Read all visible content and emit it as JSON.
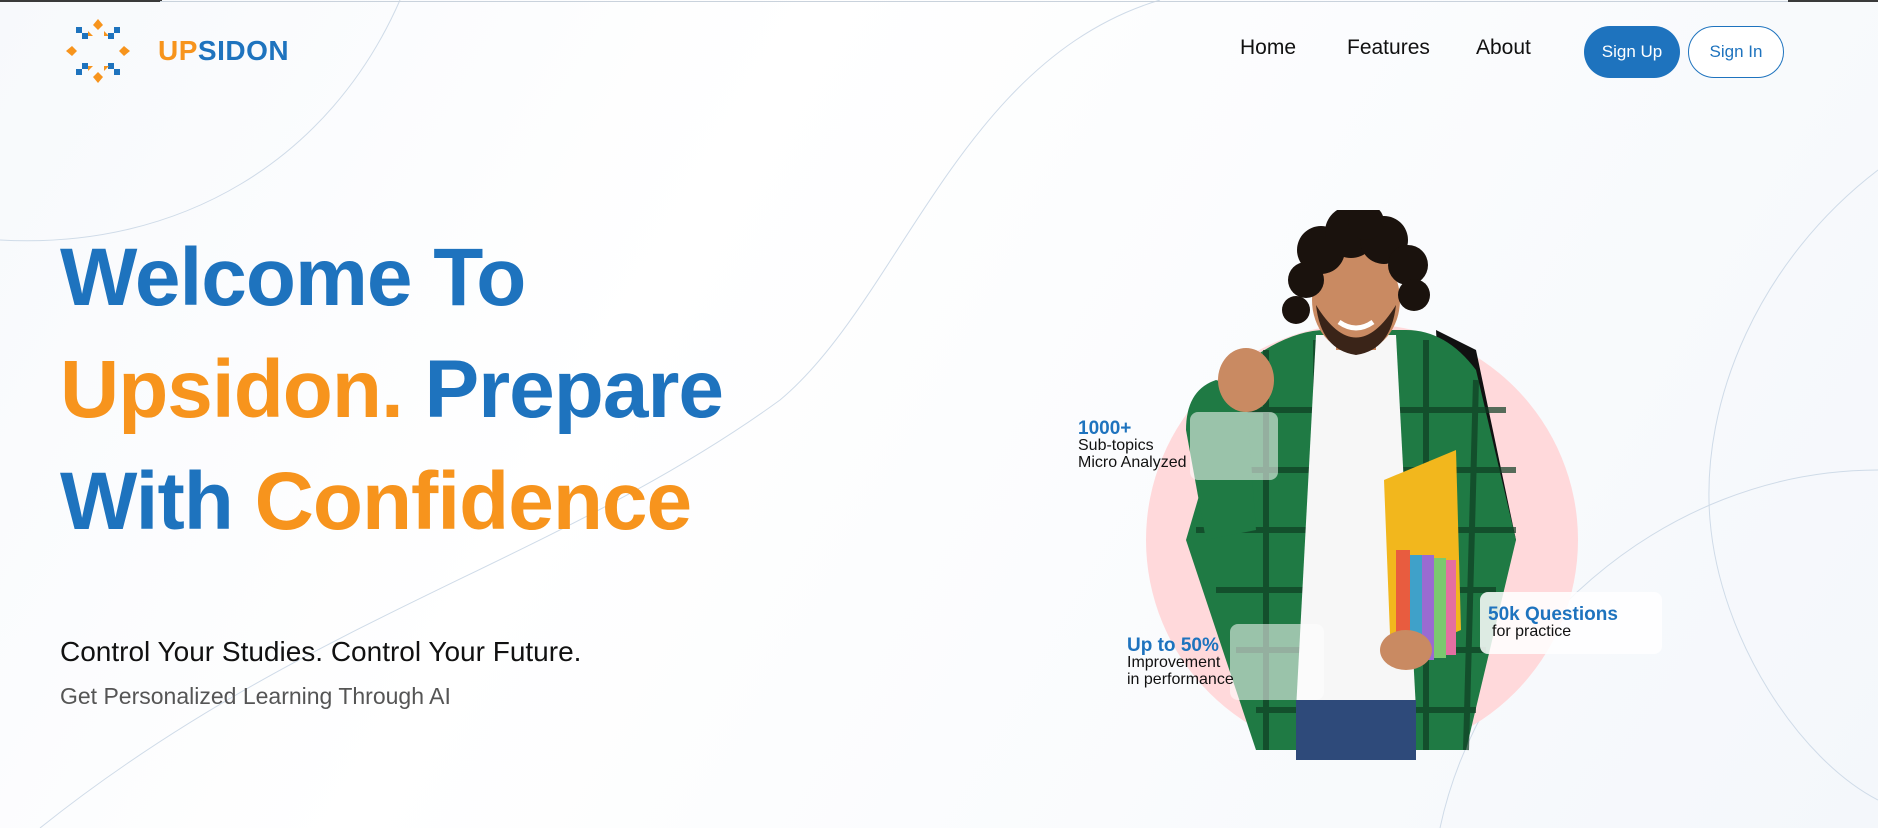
{
  "brand": {
    "prefix": "UP",
    "suffix": "SIDON",
    "colors": {
      "orange": "#f7941d",
      "blue": "#1e73be"
    }
  },
  "nav": {
    "home": "Home",
    "features": "Features",
    "about": "About"
  },
  "auth": {
    "sign_up": "Sign Up",
    "sign_in": "Sign In"
  },
  "hero": {
    "line1": "Welcome To",
    "line2_orange": "Upsidon.",
    "line2_blue": "Prepare",
    "line3_blue": "With",
    "line3_orange": "Confidence",
    "tagline": "Control Your Studies. Control Your Future.",
    "subtagline": "Get Personalized Learning Through AI"
  },
  "stats": [
    {
      "value": "1000+",
      "line1": "Sub-topics",
      "line2": "Micro Analyzed"
    },
    {
      "value": "Up to 50%",
      "line1": "Improvement",
      "line2": "in performance"
    },
    {
      "value": "50k Questions",
      "line1": "for practice"
    }
  ],
  "icons": {
    "logo": "upsidon-logo-icon",
    "hero_image": "student-photo"
  }
}
